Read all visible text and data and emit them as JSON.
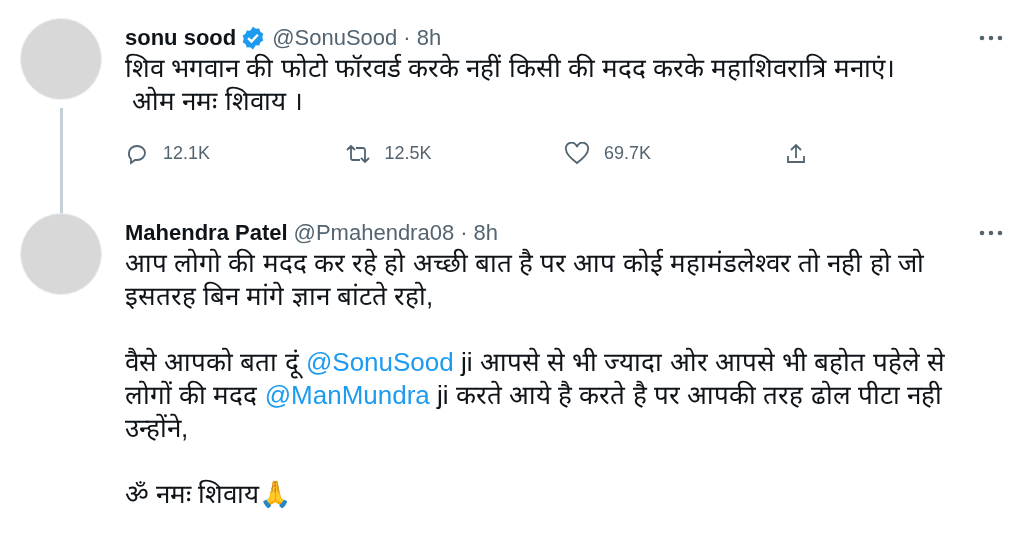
{
  "tweets": [
    {
      "name": "sonu sood",
      "verified": true,
      "handle": "@SonuSood",
      "separator": "·",
      "time": "8h",
      "thread_line": true,
      "paragraphs": [
        [
          {
            "kind": "text",
            "text": "शिव भगवान की फोटो फॉरवर्ड करके नहीं किसी की मदद करके महाशिवरात्रि मनाएं।\n ओम नमः शिवाय ।"
          }
        ]
      ],
      "actions": [
        {
          "kind": "reply",
          "count": "12.1K"
        },
        {
          "kind": "retweet",
          "count": "12.5K"
        },
        {
          "kind": "like",
          "count": "69.7K"
        },
        {
          "kind": "share"
        }
      ]
    },
    {
      "name": "Mahendra Patel",
      "verified": false,
      "handle": "@Pmahendra08",
      "separator": "·",
      "time": "8h",
      "thread_line": false,
      "paragraphs": [
        [
          {
            "kind": "text",
            "text": "आप लोगो की मदद कर रहे हो अच्छी बात है पर आप कोई महामंडलेश्वर तो नही हो जो इसतरह बिन मांगे ज्ञान बांटते रहो,"
          }
        ],
        [
          {
            "kind": "text",
            "text": "वैसे आपको बता दूं "
          },
          {
            "kind": "mention",
            "text": "@SonuSood"
          },
          {
            "kind": "text",
            "text": " ji आपसे से भी ज्यादा ओर आपसे भी बहोत पहेले से लोगों की मदद "
          },
          {
            "kind": "mention",
            "text": "@ManMundra"
          },
          {
            "kind": "text",
            "text": " ji करते आये है करते है पर आपकी तरह ढोल पीटा नही उन्होंने,"
          }
        ],
        [
          {
            "kind": "text",
            "text": "ॐ नमः शिवाय🙏"
          }
        ]
      ]
    }
  ]
}
